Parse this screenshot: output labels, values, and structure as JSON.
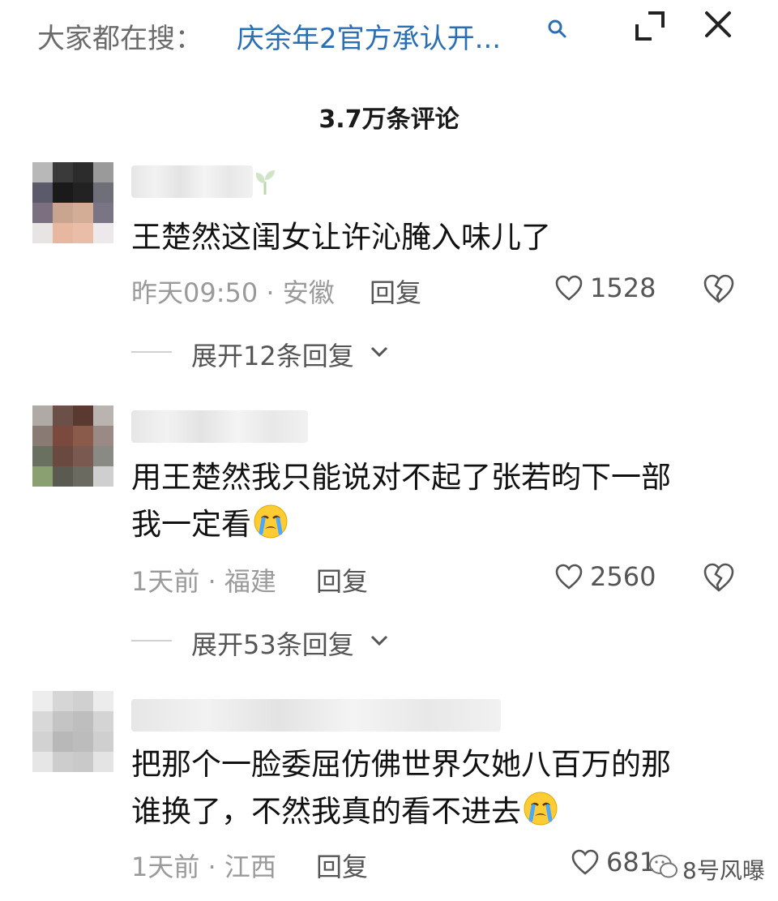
{
  "header": {
    "search_prefix": "大家都在搜：",
    "search_query": "庆余年2官方承认开...",
    "icons": [
      "search-icon",
      "expand-icon",
      "close-icon"
    ]
  },
  "comments_count": "3.7万条评论",
  "comments": [
    {
      "text_lines": [
        "王楚然这闺女让许沁腌入味儿了"
      ],
      "time_location": "昨天09:50 · 安徽",
      "reply_label": "回复",
      "likes": "1528",
      "expand_label": "展开12条回复"
    },
    {
      "text_lines": [
        "用王楚然我只能说对不起了张若昀下一部",
        "我一定看"
      ],
      "time_location": "1天前 · 福建",
      "reply_label": "回复",
      "likes": "2560",
      "expand_label": "展开53条回复"
    },
    {
      "text_lines": [
        "把那个一脸委屈仿佛世界欠她八百万的那",
        "谁换了，不然我真的看不进去"
      ],
      "time_location": "1天前 · 江西",
      "reply_label": "回复",
      "likes": "681"
    }
  ],
  "watermark": "8号风曝",
  "colors": {
    "search_query": "#2a6fb6",
    "meta": "#9a9a9a",
    "text": "#111111"
  }
}
